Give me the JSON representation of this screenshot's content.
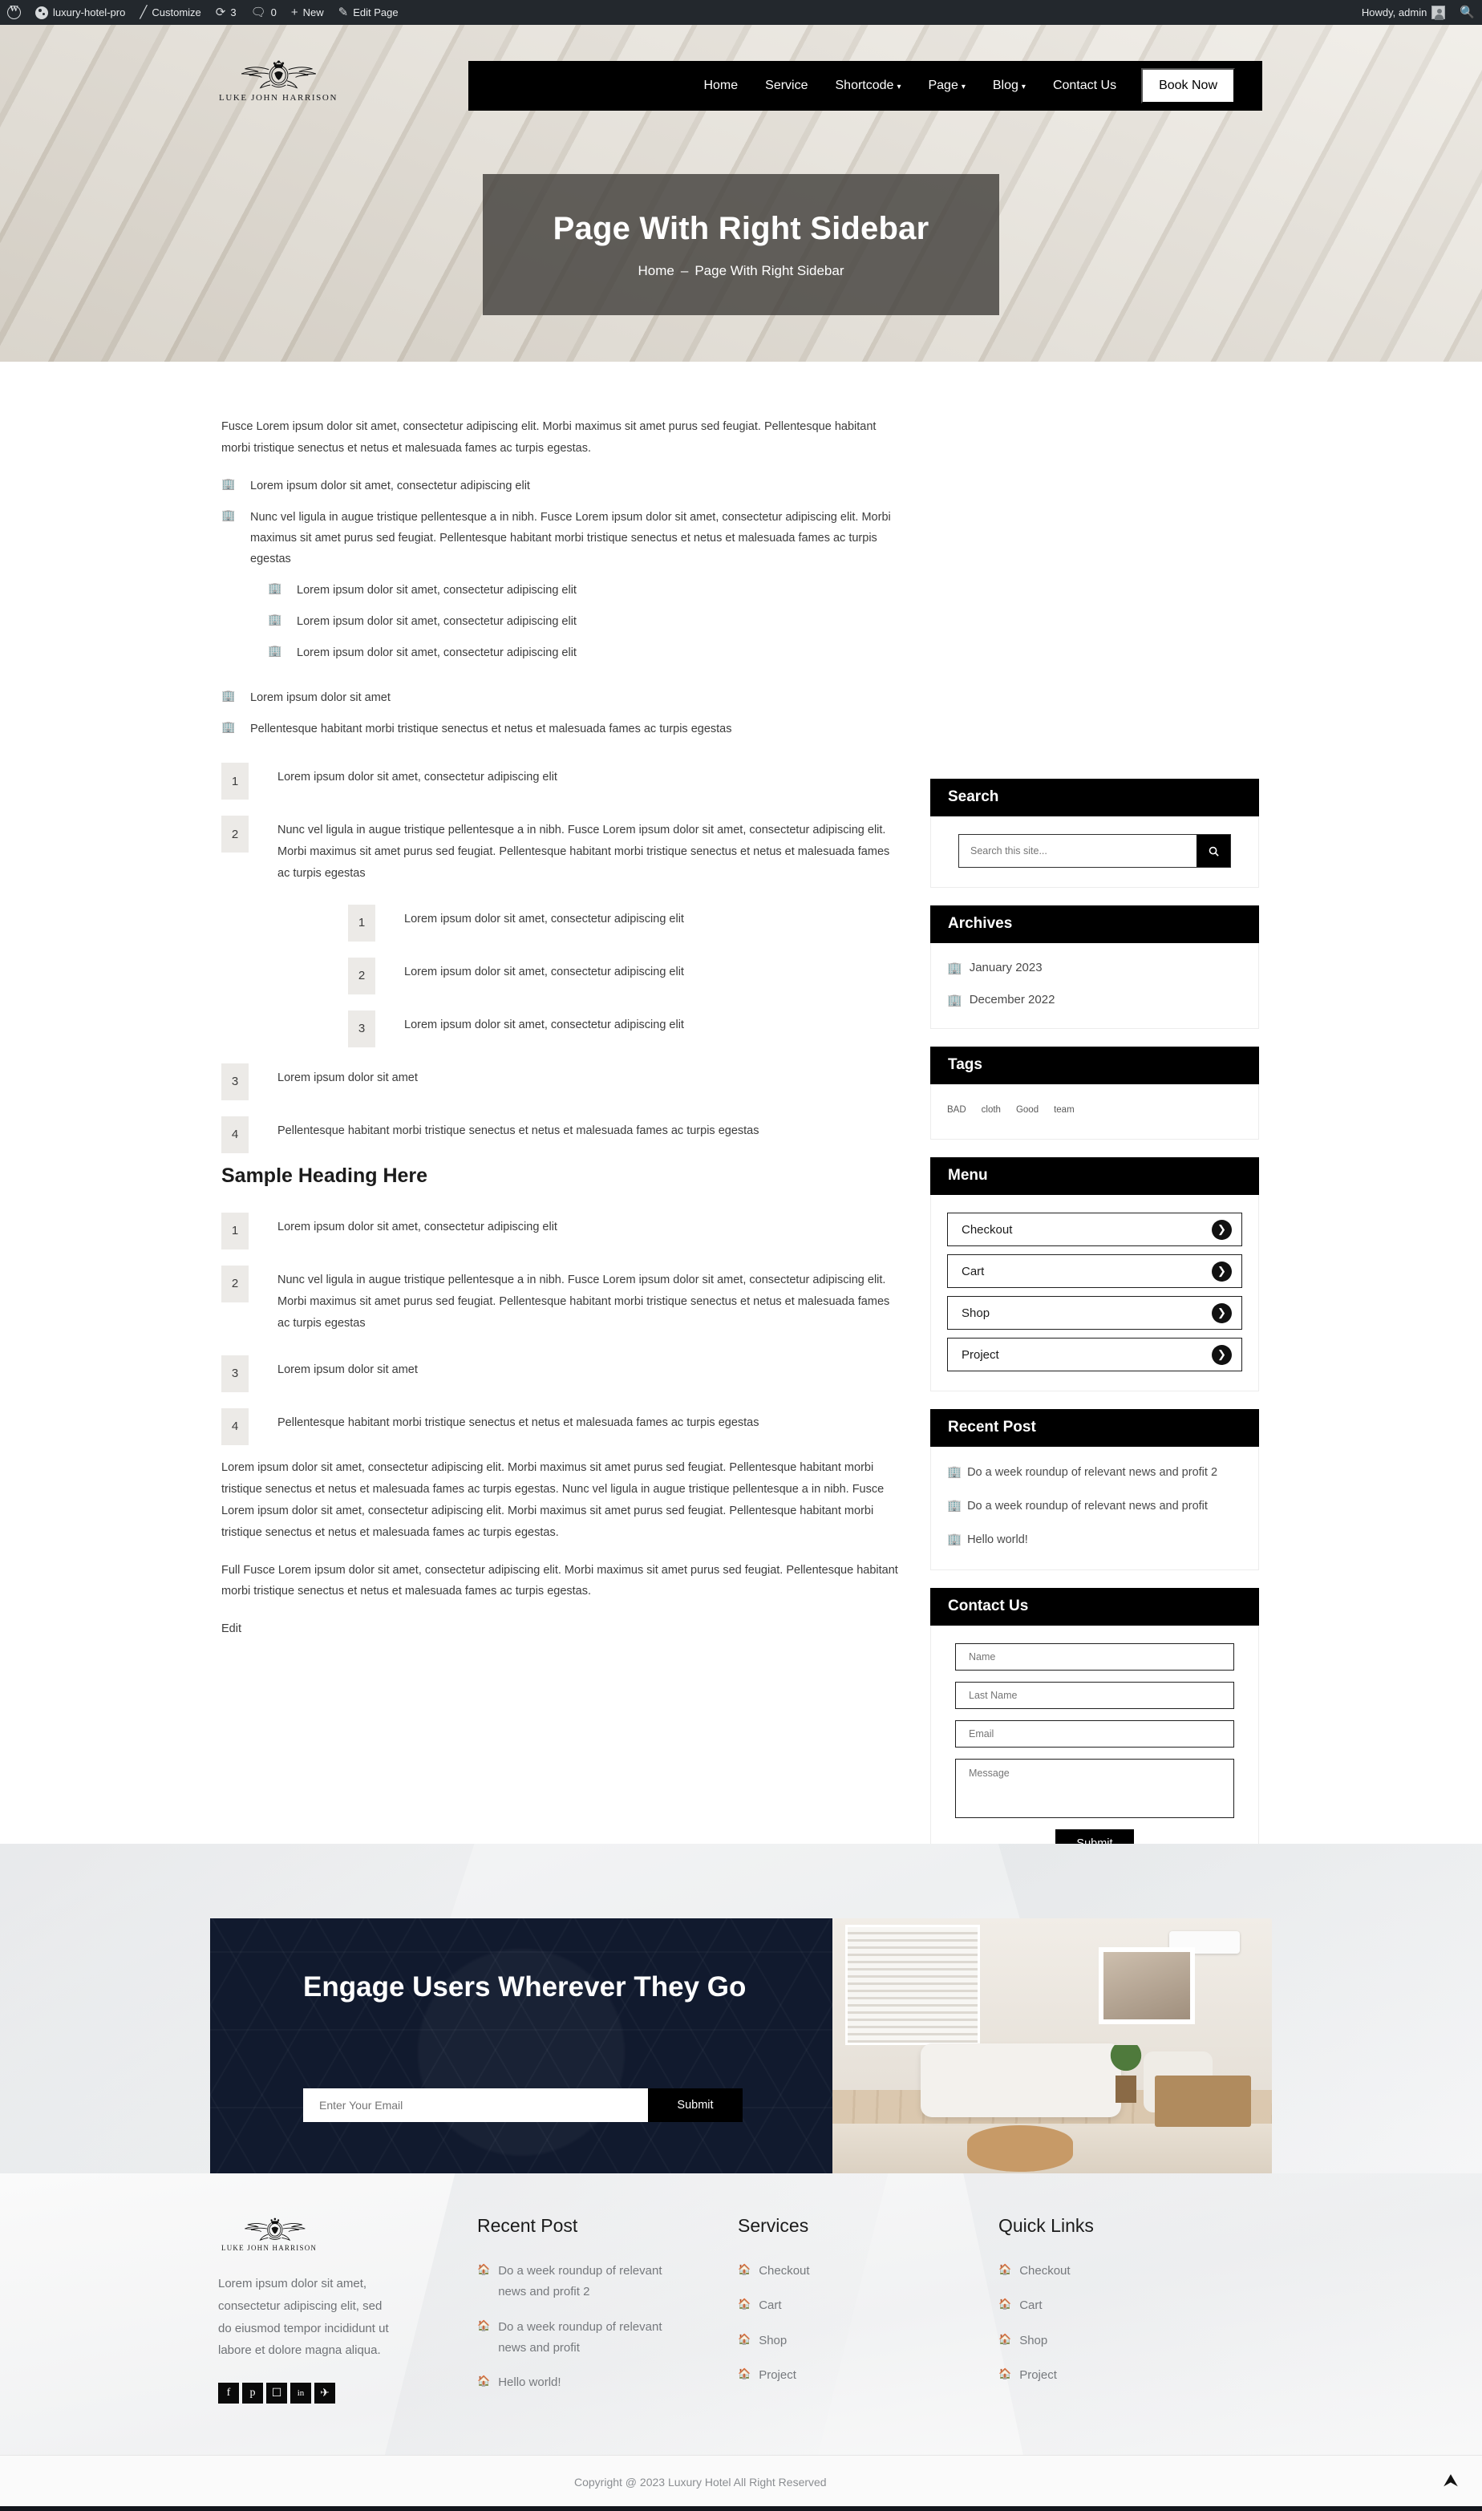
{
  "adminbar": {
    "wp_logo": "wordpress-logo",
    "site_name": "luxury-hotel-pro",
    "customize": "Customize",
    "updates_count": "3",
    "comments_count": "0",
    "new": "New",
    "edit_page": "Edit Page",
    "howdy": "Howdy, admin",
    "search_icon": "search-icon"
  },
  "header": {
    "logo_text": "LUKE JOHN HARRISON",
    "nav": [
      {
        "label": "Home",
        "caret": false
      },
      {
        "label": "Service",
        "caret": false
      },
      {
        "label": "Shortcode",
        "caret": true
      },
      {
        "label": "Page",
        "caret": true
      },
      {
        "label": "Blog",
        "caret": true
      },
      {
        "label": "Contact Us",
        "caret": false
      }
    ],
    "cta": "Book Now"
  },
  "page_banner": {
    "title": "Page With Right Sidebar",
    "crumb_home": "Home",
    "crumb_sep": "–",
    "crumb_current": "Page With Right Sidebar"
  },
  "content": {
    "intro": "Fusce Lorem ipsum dolor sit amet, consectetur adipiscing elit. Morbi maximus sit amet purus sed feugiat. Pellentesque habitant morbi tristique senectus et netus et malesuada fames ac turpis egestas.",
    "bullet_icon": "building-icon",
    "bullets_1": [
      "Lorem ipsum dolor sit amet, consectetur adipiscing elit",
      "Nunc vel ligula in augue tristique pellentesque a in nibh. Fusce Lorem ipsum dolor sit amet, consectetur adipiscing elit. Morbi maximus sit amet purus sed feugiat. Pellentesque habitant morbi tristique senectus et netus et malesuada fames ac turpis egestas"
    ],
    "bullets_nested": [
      "Lorem ipsum dolor sit amet, consectetur adipiscing elit",
      "Lorem ipsum dolor sit amet, consectetur adipiscing elit",
      "Lorem ipsum dolor sit amet, consectetur adipiscing elit"
    ],
    "bullets_2": [
      "Lorem ipsum dolor sit amet",
      "Pellentesque habitant morbi tristique senectus et netus et malesuada fames ac turpis egestas"
    ],
    "ordered_1": [
      "Lorem ipsum dolor sit amet, consectetur adipiscing elit",
      "Nunc vel ligula in augue tristique pellentesque a in nibh. Fusce Lorem ipsum dolor sit amet, consectetur adipiscing elit. Morbi maximus sit amet purus sed feugiat. Pellentesque habitant morbi tristique senectus et netus et malesuada fames ac turpis egestas",
      "Lorem ipsum dolor sit amet",
      "Pellentesque habitant morbi tristique senectus et netus et malesuada fames ac turpis egestas"
    ],
    "ordered_nested": [
      "Lorem ipsum dolor sit amet, consectetur adipiscing elit",
      "Lorem ipsum dolor sit amet, consectetur adipiscing elit",
      "Lorem ipsum dolor sit amet, consectetur adipiscing elit"
    ],
    "heading": "Sample Heading Here",
    "ordered_2": [
      "Lorem ipsum dolor sit amet, consectetur adipiscing elit",
      "Nunc vel ligula in augue tristique pellentesque a in nibh. Fusce Lorem ipsum dolor sit amet, consectetur adipiscing elit. Morbi maximus sit amet purus sed feugiat. Pellentesque habitant morbi tristique senectus et netus et malesuada fames ac turpis egestas",
      "Lorem ipsum dolor sit amet",
      "Pellentesque habitant morbi tristique senectus et netus et malesuada fames ac turpis egestas"
    ],
    "para_1": "Lorem ipsum dolor sit amet, consectetur adipiscing elit. Morbi maximus sit amet purus sed feugiat. Pellentesque habitant morbi tristique senectus et netus et malesuada fames ac turpis egestas. Nunc vel ligula in augue tristique pellentesque a in nibh. Fusce Lorem ipsum dolor sit amet, consectetur adipiscing elit. Morbi maximus sit amet purus sed feugiat. Pellentesque habitant morbi tristique senectus et netus et malesuada fames ac turpis egestas.",
    "para_2": "Full Fusce Lorem ipsum dolor sit amet, consectetur adipiscing elit. Morbi maximus sit amet purus sed feugiat. Pellentesque habitant morbi tristique senectus et netus et malesuada fames ac turpis egestas.",
    "edit": "Edit"
  },
  "sidebar": {
    "search": {
      "title": "Search",
      "placeholder": "Search this site...",
      "value": "",
      "button_icon": "search-icon"
    },
    "archives": {
      "title": "Archives",
      "items": [
        "January 2023",
        "December 2022"
      ]
    },
    "tags": {
      "title": "Tags",
      "items": [
        "BAD",
        "cloth",
        "Good",
        "team"
      ]
    },
    "menu": {
      "title": "Menu",
      "items": [
        "Checkout",
        "Cart",
        "Shop",
        "Project"
      ],
      "item_icon": "chevron-right-circle-icon"
    },
    "recent": {
      "title": "Recent Post",
      "items": [
        "Do a week roundup of relevant news and profit 2",
        "Do a week roundup of relevant news and profit",
        "Hello world!"
      ]
    },
    "contact": {
      "title": "Contact Us",
      "name_placeholder": "Name",
      "lastname_placeholder": "Last Name",
      "email_placeholder": "Email",
      "message_placeholder": "Message",
      "submit": "Submit"
    }
  },
  "newsletter": {
    "heading": "Engage Users Wherever They Go",
    "placeholder": "Enter Your Email",
    "value": "",
    "submit": "Submit"
  },
  "footer": {
    "logo_text": "LUKE JOHN HARRISON",
    "about": "Lorem ipsum dolor sit amet, consectetur adipiscing elit, sed do eiusmod tempor incididunt ut labore et dolore magna aliqua.",
    "socials": [
      {
        "name": "facebook-icon",
        "glyph": "f"
      },
      {
        "name": "pinterest-icon",
        "glyph": "p"
      },
      {
        "name": "instagram-icon",
        "glyph": "▢"
      },
      {
        "name": "linkedin-icon",
        "glyph": "in"
      },
      {
        "name": "twitter-icon",
        "glyph": "ᵛ"
      }
    ],
    "recent": {
      "title": "Recent Post",
      "items": [
        "Do a week roundup of relevant news and profit 2",
        "Do a week roundup of relevant news and profit",
        "Hello world!"
      ]
    },
    "services": {
      "title": "Services",
      "items": [
        "Checkout",
        "Cart",
        "Shop",
        "Project"
      ]
    },
    "quick": {
      "title": "Quick Links",
      "items": [
        "Checkout",
        "Cart",
        "Shop",
        "Project"
      ]
    },
    "list_icon": "home-icon",
    "copyright": "Copyright @ 2023 Luxury Hotel All Right Reserved",
    "to_top_icon": "scroll-to-top-icon"
  },
  "colors": {
    "accent": "#000000",
    "adminbar": "#23282d",
    "newsletter_bg": "#111a2e",
    "banner_overlay": "#3f3c38"
  }
}
